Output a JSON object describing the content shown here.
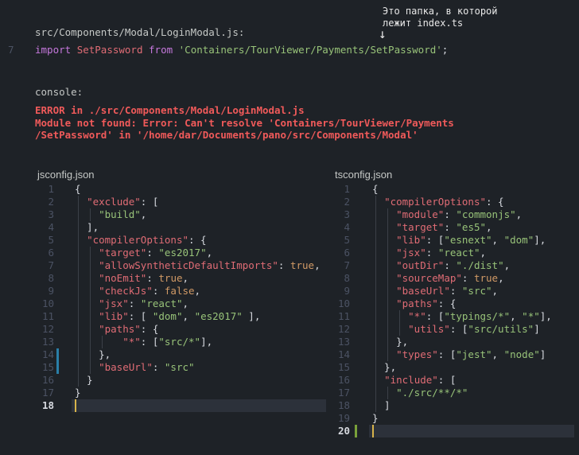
{
  "annotation": {
    "line1": "Это папка, в которой",
    "line2": "лежит index.ts",
    "arrow": "↓"
  },
  "import_snippet": {
    "file_path": "src/Components/Modal/LoginModal.js:",
    "line_number": "7",
    "keyword_import": "import",
    "identifier": "SetPassword",
    "keyword_from": "from",
    "module_path": "'Containers/TourViewer/Payments/SetPassword'",
    "terminator": ";"
  },
  "console": {
    "label": "console:",
    "error_lines": [
      "ERROR in ./src/Components/Modal/LoginModal.js",
      "Module not found: Error: Can't resolve 'Containers/TourViewer/Payments",
      "/SetPassword' in '/home/dar/Documents/pano/src/Components/Modal'"
    ]
  },
  "jsconfig": {
    "filename": "jsconfig.json",
    "line_numbers": [
      "1",
      "2",
      "3",
      "4",
      "5",
      "6",
      "7",
      "8",
      "9",
      "10",
      "11",
      "12",
      "13",
      "14",
      "15",
      "16",
      "17",
      "18"
    ],
    "lines": [
      [
        [
          "p",
          "{"
        ]
      ],
      [
        [
          "p",
          "  "
        ],
        [
          "k",
          "\"exclude\""
        ],
        [
          "p",
          ": ["
        ]
      ],
      [
        [
          "p",
          "    "
        ],
        [
          "s",
          "\"build\""
        ],
        [
          "p",
          ","
        ]
      ],
      [
        [
          "p",
          "  ],"
        ]
      ],
      [
        [
          "p",
          "  "
        ],
        [
          "k",
          "\"compilerOptions\""
        ],
        [
          "p",
          ": {"
        ]
      ],
      [
        [
          "p",
          "    "
        ],
        [
          "k",
          "\"target\""
        ],
        [
          "p",
          ": "
        ],
        [
          "s",
          "\"es2017\""
        ],
        [
          "p",
          ","
        ]
      ],
      [
        [
          "p",
          "    "
        ],
        [
          "k",
          "\"allowSyntheticDefaultImports\""
        ],
        [
          "p",
          ": "
        ],
        [
          "b",
          "true"
        ],
        [
          "p",
          ","
        ]
      ],
      [
        [
          "p",
          "    "
        ],
        [
          "k",
          "\"noEmit\""
        ],
        [
          "p",
          ": "
        ],
        [
          "b",
          "true"
        ],
        [
          "p",
          ","
        ]
      ],
      [
        [
          "p",
          "    "
        ],
        [
          "k",
          "\"checkJs\""
        ],
        [
          "p",
          ": "
        ],
        [
          "b",
          "false"
        ],
        [
          "p",
          ","
        ]
      ],
      [
        [
          "p",
          "    "
        ],
        [
          "k",
          "\"jsx\""
        ],
        [
          "p",
          ": "
        ],
        [
          "s",
          "\"react\""
        ],
        [
          "p",
          ","
        ]
      ],
      [
        [
          "p",
          "    "
        ],
        [
          "k",
          "\"lib\""
        ],
        [
          "p",
          ": [ "
        ],
        [
          "s",
          "\"dom\""
        ],
        [
          "p",
          ", "
        ],
        [
          "s",
          "\"es2017\""
        ],
        [
          "p",
          " ],"
        ]
      ],
      [
        [
          "p",
          "    "
        ],
        [
          "k",
          "\"paths\""
        ],
        [
          "p",
          ": {"
        ]
      ],
      [
        [
          "p",
          "        "
        ],
        [
          "k",
          "\"*\""
        ],
        [
          "p",
          ": ["
        ],
        [
          "s",
          "\"src/*\""
        ],
        [
          "p",
          "],"
        ]
      ],
      [
        [
          "p",
          "    },"
        ]
      ],
      [
        [
          "p",
          "    "
        ],
        [
          "k",
          "\"baseUrl\""
        ],
        [
          "p",
          ": "
        ],
        [
          "s",
          "\"src\""
        ]
      ],
      [
        [
          "p",
          "  }"
        ]
      ],
      [
        [
          "p",
          "}"
        ]
      ],
      [
        [
          "p",
          ""
        ]
      ]
    ]
  },
  "tsconfig": {
    "filename": "tsconfig.json",
    "line_numbers": [
      "1",
      "2",
      "3",
      "4",
      "5",
      "6",
      "7",
      "8",
      "9",
      "10",
      "11",
      "12",
      "13",
      "14",
      "15",
      "16",
      "17",
      "18",
      "19",
      "20"
    ],
    "lines": [
      [
        [
          "p",
          "{"
        ]
      ],
      [
        [
          "p",
          "  "
        ],
        [
          "k",
          "\"compilerOptions\""
        ],
        [
          "p",
          ": {"
        ]
      ],
      [
        [
          "p",
          "    "
        ],
        [
          "k",
          "\"module\""
        ],
        [
          "p",
          ": "
        ],
        [
          "s",
          "\"commonjs\""
        ],
        [
          "p",
          ","
        ]
      ],
      [
        [
          "p",
          "    "
        ],
        [
          "k",
          "\"target\""
        ],
        [
          "p",
          ": "
        ],
        [
          "s",
          "\"es5\""
        ],
        [
          "p",
          ","
        ]
      ],
      [
        [
          "p",
          "    "
        ],
        [
          "k",
          "\"lib\""
        ],
        [
          "p",
          ": ["
        ],
        [
          "s",
          "\"esnext\""
        ],
        [
          "p",
          ", "
        ],
        [
          "s",
          "\"dom\""
        ],
        [
          "p",
          "],"
        ]
      ],
      [
        [
          "p",
          "    "
        ],
        [
          "k",
          "\"jsx\""
        ],
        [
          "p",
          ": "
        ],
        [
          "s",
          "\"react\""
        ],
        [
          "p",
          ","
        ]
      ],
      [
        [
          "p",
          "    "
        ],
        [
          "k",
          "\"outDir\""
        ],
        [
          "p",
          ": "
        ],
        [
          "s",
          "\"./dist\""
        ],
        [
          "p",
          ","
        ]
      ],
      [
        [
          "p",
          "    "
        ],
        [
          "k",
          "\"sourceMap\""
        ],
        [
          "p",
          ": "
        ],
        [
          "b",
          "true"
        ],
        [
          "p",
          ","
        ]
      ],
      [
        [
          "p",
          "    "
        ],
        [
          "k",
          "\"baseUrl\""
        ],
        [
          "p",
          ": "
        ],
        [
          "s",
          "\"src\""
        ],
        [
          "p",
          ","
        ]
      ],
      [
        [
          "p",
          "    "
        ],
        [
          "k",
          "\"paths\""
        ],
        [
          "p",
          ": {"
        ]
      ],
      [
        [
          "p",
          "      "
        ],
        [
          "k",
          "\"*\""
        ],
        [
          "p",
          ": ["
        ],
        [
          "s",
          "\"typings/*\""
        ],
        [
          "p",
          ", "
        ],
        [
          "s",
          "\"*\""
        ],
        [
          "p",
          "],"
        ]
      ],
      [
        [
          "p",
          "      "
        ],
        [
          "k",
          "\"utils\""
        ],
        [
          "p",
          ": ["
        ],
        [
          "s",
          "\"src/utils\""
        ],
        [
          "p",
          "]"
        ]
      ],
      [
        [
          "p",
          "    },"
        ]
      ],
      [
        [
          "p",
          "    "
        ],
        [
          "k",
          "\"types\""
        ],
        [
          "p",
          ": ["
        ],
        [
          "s",
          "\"jest\""
        ],
        [
          "p",
          ", "
        ],
        [
          "s",
          "\"node\""
        ],
        [
          "p",
          "]"
        ]
      ],
      [
        [
          "p",
          "  },"
        ]
      ],
      [
        [
          "p",
          "  "
        ],
        [
          "k",
          "\"include\""
        ],
        [
          "p",
          ": ["
        ]
      ],
      [
        [
          "p",
          "    "
        ],
        [
          "s",
          "\"./src/**/*\""
        ]
      ],
      [
        [
          "p",
          "  ]"
        ]
      ],
      [
        [
          "p",
          "}"
        ]
      ],
      [
        [
          "p",
          ""
        ]
      ]
    ]
  },
  "colors": {
    "background": "#1e2227",
    "keyword": "#c678dd",
    "property": "#e06c75",
    "string": "#98c379",
    "boolean": "#d19a66",
    "error": "#f05a5a",
    "modified_marker_js": "#2a7fa8",
    "modified_marker_ts": "#7aa13a",
    "caret": "#d7b34a"
  }
}
